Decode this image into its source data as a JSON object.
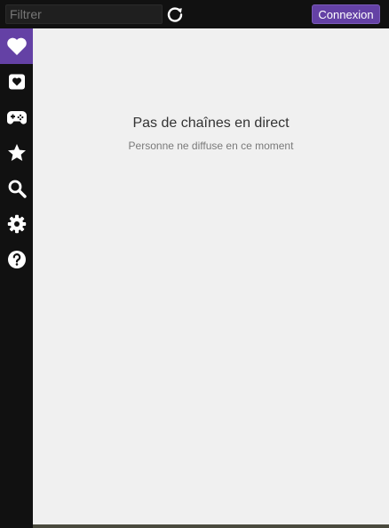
{
  "topbar": {
    "filter_placeholder": "Filtrer",
    "filter_value": "",
    "refresh_icon": "refresh-icon",
    "connect_label": "Connexion"
  },
  "sidebar": {
    "items": [
      {
        "icon": "heart-icon",
        "active": true
      },
      {
        "icon": "heart-card-icon",
        "active": false
      },
      {
        "icon": "gamepad-icon",
        "active": false
      },
      {
        "icon": "star-icon",
        "active": false
      },
      {
        "icon": "search-icon",
        "active": false
      },
      {
        "icon": "gear-icon",
        "active": false
      },
      {
        "icon": "help-icon",
        "active": false
      }
    ]
  },
  "main": {
    "empty_title": "Pas de chaînes en direct",
    "empty_subtitle": "Personne ne diffuse en ce moment"
  },
  "colors": {
    "accent": "#6441a5",
    "chrome": "#111111",
    "content_bg": "#f0f0f0"
  }
}
